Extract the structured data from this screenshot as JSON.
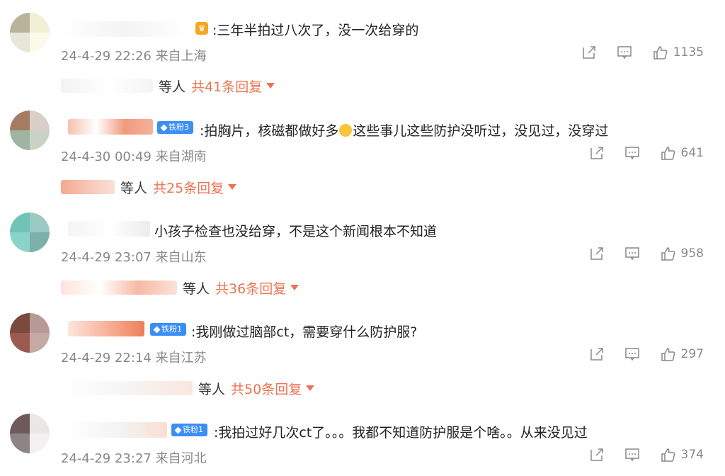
{
  "comments": [
    {
      "text": ":三年半拍过八次了，没一次给穿的",
      "time": "24-4-29 22:26",
      "location": "来自上海",
      "likes": "1135",
      "reply_etc": "等人",
      "reply_count": "共41条回复",
      "badge": ""
    },
    {
      "text_a": ":拍胸片，核磁都做好多",
      "text_b": "这些事儿这些防护没听过，没见过，没穿过",
      "time": "24-4-30 00:49",
      "location": "来自湖南",
      "likes": "641",
      "reply_etc": "等人",
      "reply_count": "共25条回复",
      "badge": "铁粉3"
    },
    {
      "text": "小孩子检查也没给穿，不是这个新闻根本不知道",
      "time": "24-4-29 23:07",
      "location": "来自山东",
      "likes": "958",
      "reply_etc": "等人",
      "reply_count": "共36条回复",
      "badge": ""
    },
    {
      "text": ":我刚做过脑部ct，需要穿什么防护服?",
      "time": "24-4-29 22:14",
      "location": "来自江苏",
      "likes": "297",
      "reply_etc": "等人",
      "reply_count": "共50条回复",
      "badge": "铁粉1"
    },
    {
      "text": ":我拍过好几次ct了。。。我都不知道防护服是个啥。。从来没见过",
      "time": "24-4-29 23:27",
      "location": "来自河北",
      "likes": "374",
      "badge": "铁粉1"
    }
  ],
  "icons": {
    "share": "share-icon",
    "comment": "comment-icon",
    "like": "thumbs-up-icon"
  },
  "colors": {
    "accent": "#eb7350",
    "badge": "#3b8ef5",
    "meta": "#888888"
  }
}
